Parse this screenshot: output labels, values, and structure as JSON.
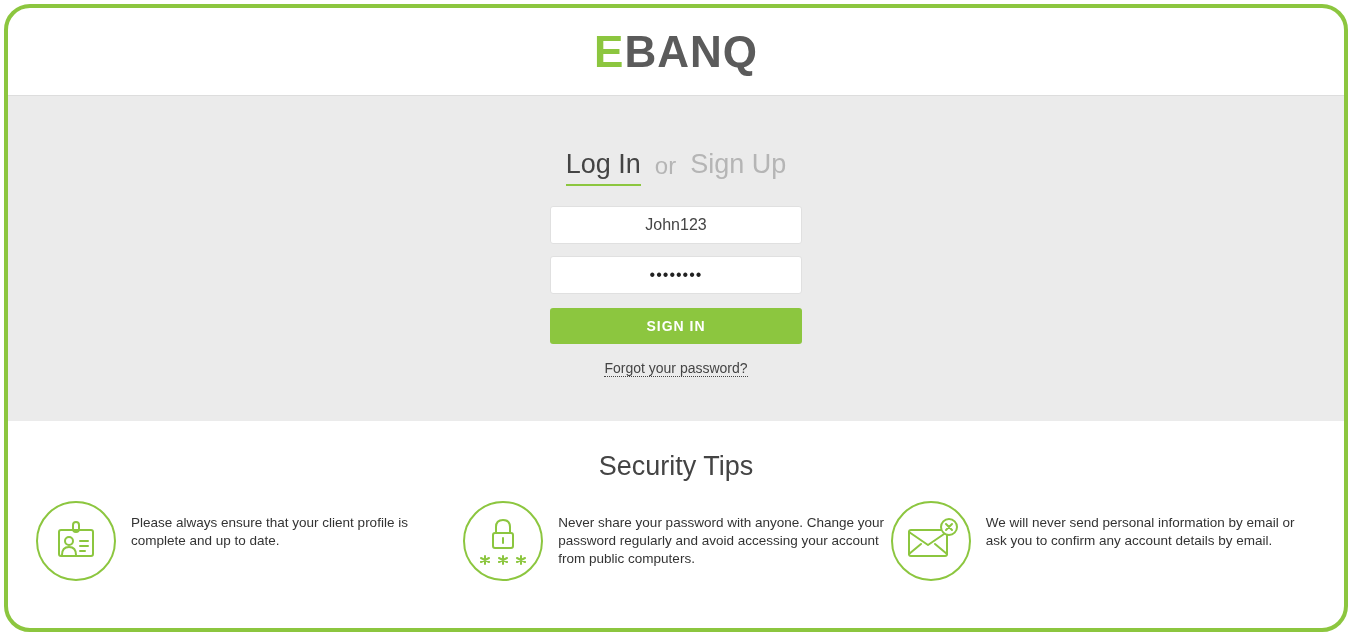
{
  "logo": {
    "text": "EBANQ"
  },
  "auth_tabs": [
    {
      "label": "Log In",
      "selected": true
    },
    {
      "label": "Sign Up",
      "selected": false
    }
  ],
  "tab_separator": "or",
  "form": {
    "username": {
      "value": "John123"
    },
    "password": {
      "value": "••••••••"
    },
    "submit": "SIGN IN",
    "forgot_link": "Forgot your password?"
  },
  "security_tips": {
    "title": "Security Tips",
    "tips": [
      {
        "kind": "id-card",
        "text": "Please always ensure that your client profile is complete and up to date."
      },
      {
        "kind": "lock",
        "text": "Never share your password with anyone. Change your password regularly and avoid accessing your account from public computers."
      },
      {
        "kind": "mail",
        "text": "We will never send personal information by email or ask you to confirm any account details by email."
      }
    ]
  }
}
